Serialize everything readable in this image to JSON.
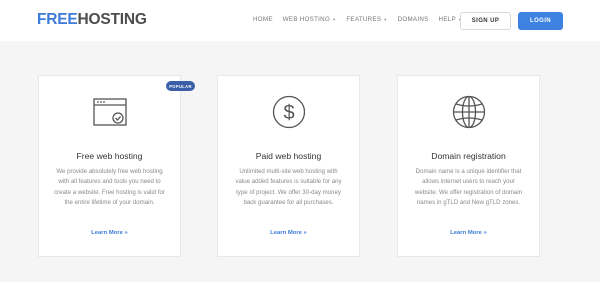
{
  "header": {
    "logo": {
      "part1": "FREE",
      "part2": "HOSTING"
    },
    "nav": [
      {
        "label": "HOME",
        "has_dropdown": false
      },
      {
        "label": "WEB HOSTING",
        "has_dropdown": true
      },
      {
        "label": "FEATURES",
        "has_dropdown": true
      },
      {
        "label": "DOMAINS",
        "has_dropdown": false
      },
      {
        "label": "HELP",
        "has_dropdown": true
      }
    ],
    "signup_label": "SIGN UP",
    "login_label": "LOGIN"
  },
  "cards": [
    {
      "icon": "browser-check-icon",
      "badge": "POPULAR",
      "title": "Free web hosting",
      "description": "We provide absolutely free web hosting with all features and tools you need to create a website. Free hosting is valid for the entire lifetime of your domain.",
      "link": "Learn More »"
    },
    {
      "icon": "dollar-circle-icon",
      "title": "Paid web hosting",
      "description": "Unlimited multi-site web hosting with value added features is suitable for any type of project. We offer 30-day money back guarantee for all purchases.",
      "link": "Learn More »"
    },
    {
      "icon": "globe-icon",
      "title": "Domain registration",
      "description": "Domain name is a unique identifier that allows internet users to reach your website. We offer registration of domain names in gTLD and New gTLD zones.",
      "link": "Learn More »"
    }
  ],
  "colors": {
    "brand_blue": "#3d7bd9",
    "login_blue": "#3d82e0",
    "badge_blue": "#3a5fa8",
    "background": "#f5f5f5"
  }
}
